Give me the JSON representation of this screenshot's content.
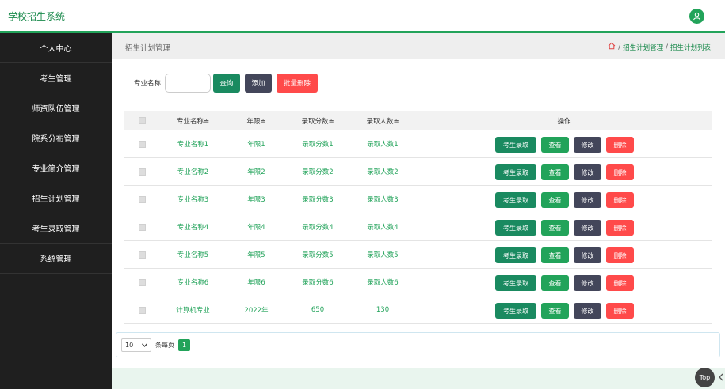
{
  "app": {
    "title": "学校招生系统"
  },
  "sidebar": {
    "items": [
      {
        "label": "个人中心"
      },
      {
        "label": "考生管理"
      },
      {
        "label": "师资队伍管理"
      },
      {
        "label": "院系分布管理"
      },
      {
        "label": "专业简介管理"
      },
      {
        "label": "招生计划管理"
      },
      {
        "label": "考生录取管理"
      },
      {
        "label": "系统管理"
      }
    ]
  },
  "header": {
    "page_title": "招生计划管理",
    "breadcrumb": [
      "招生计划管理",
      "招生计划列表"
    ],
    "breadcrumb_sep": "/"
  },
  "search": {
    "label": "专业名称",
    "value": "",
    "query_button": "查询",
    "add_button": "添加",
    "batch_delete_button": "批量删除"
  },
  "table": {
    "columns": [
      "专业名称≑",
      "年限≑",
      "录取分数≑",
      "录取人数≑",
      "操作"
    ],
    "actions": [
      "考生录取",
      "查看",
      "修改",
      "删除"
    ],
    "rows": [
      {
        "name": "专业名称1",
        "years": "年限1",
        "score": "录取分数1",
        "count": "录取人数1"
      },
      {
        "name": "专业名称2",
        "years": "年限2",
        "score": "录取分数2",
        "count": "录取人数2"
      },
      {
        "name": "专业名称3",
        "years": "年限3",
        "score": "录取分数3",
        "count": "录取人数3"
      },
      {
        "name": "专业名称4",
        "years": "年限4",
        "score": "录取分数4",
        "count": "录取人数4"
      },
      {
        "name": "专业名称5",
        "years": "年限5",
        "score": "录取分数5",
        "count": "录取人数5"
      },
      {
        "name": "专业名称6",
        "years": "年限6",
        "score": "录取分数6",
        "count": "录取人数6"
      },
      {
        "name": "计算机专业",
        "years": "2022年",
        "score": "650",
        "count": "130"
      }
    ]
  },
  "pagination": {
    "page_size": "10",
    "per_page_label": "条每页",
    "current_page": "1"
  },
  "footer": {
    "top_button": "Top"
  },
  "icons": {
    "user": "user-icon",
    "home": "home-icon",
    "dropdown": "chevron-down-icon",
    "collapse": "chevron-left-icon"
  },
  "colors": {
    "brand_green": "#22a35a",
    "dark_green": "#1a8a60",
    "sidebar_bg": "#1f1f1f",
    "danger": "#ff4a4a",
    "slate": "#43465a"
  }
}
